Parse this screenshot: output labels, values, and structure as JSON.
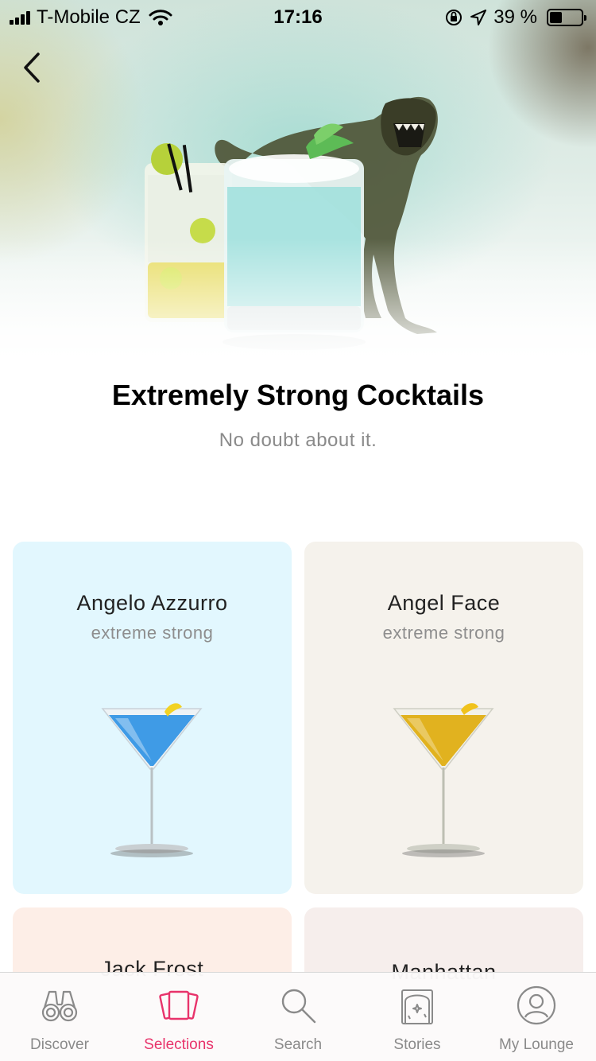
{
  "status_bar": {
    "carrier": "T-Mobile CZ",
    "time": "17:16",
    "battery_percent": "39 %",
    "battery_level": 0.39
  },
  "header": {
    "title": "Extremely Strong Cocktails",
    "subtitle": "No doubt about it."
  },
  "cards": [
    {
      "name": "Angelo Azzurro",
      "strength": "extreme strong",
      "bg_color": "#e2f7fe",
      "drink_color": "#3f9be6"
    },
    {
      "name": "Angel Face",
      "strength": "extreme strong",
      "bg_color": "#f5f2ec",
      "drink_color": "#e1b21f"
    },
    {
      "name": "Jack Frost",
      "bg_color": "#fdeee7"
    },
    {
      "name": "Manhattan",
      "bg_color": "#f6eeec"
    }
  ],
  "tab_bar": {
    "tabs": [
      {
        "label": "Discover",
        "icon": "binoculars-icon"
      },
      {
        "label": "Selections",
        "icon": "cards-icon",
        "active": true
      },
      {
        "label": "Search",
        "icon": "magnifier-icon"
      },
      {
        "label": "Stories",
        "icon": "book-icon"
      },
      {
        "label": "My Lounge",
        "icon": "profile-icon"
      }
    ],
    "active_color": "#e8336b",
    "inactive_color": "#8a8a8a"
  }
}
